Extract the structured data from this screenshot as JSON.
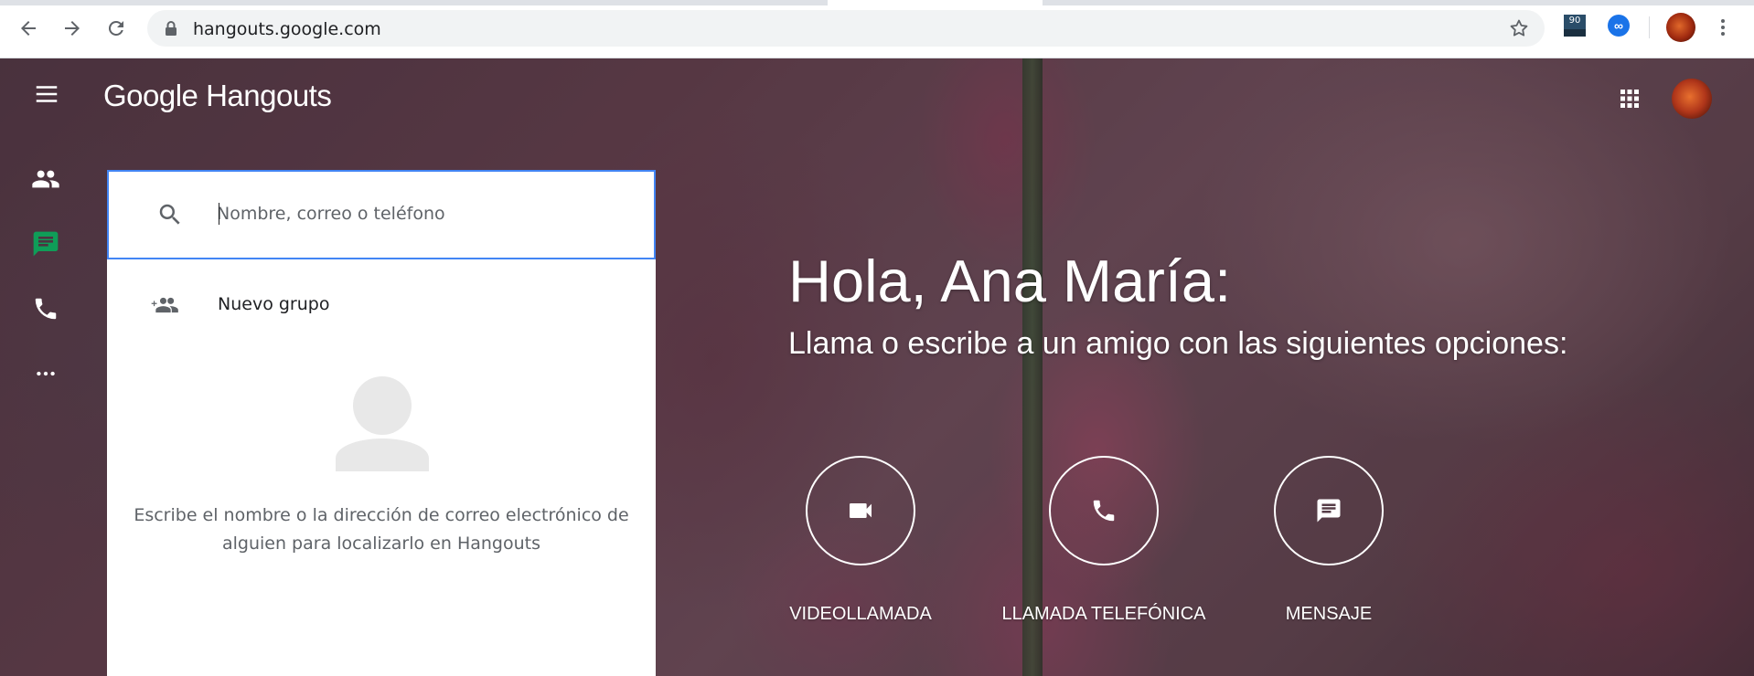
{
  "browser": {
    "url": "hangouts.google.com",
    "extension_badge": "90",
    "extension_infinity": "∞"
  },
  "app": {
    "logo": "Google Hangouts",
    "search": {
      "placeholder": "Nombre, correo o teléfono",
      "value": ""
    },
    "new_group_label": "Nuevo grupo",
    "hint": "Escribe el nombre o la dirección de correo electrónico de alguien para localizarlo en Hangouts",
    "greeting": "Hola, Ana María:",
    "subtitle": "Llama o escribe a un amigo con las siguientes opciones:",
    "actions": [
      {
        "label": "VIDEOLLAMADA",
        "icon": "videocam-icon"
      },
      {
        "label": "LLAMADA TELEFÓNICA",
        "icon": "phone-icon"
      },
      {
        "label": "MENSAJE",
        "icon": "message-icon"
      }
    ],
    "rail": [
      {
        "icon": "contacts-icon",
        "active": false
      },
      {
        "icon": "conversations-icon",
        "active": true
      },
      {
        "icon": "phone-calls-icon",
        "active": false
      },
      {
        "icon": "more-icon",
        "active": false
      }
    ],
    "colors": {
      "accent_green": "#0f9d58",
      "focus_blue": "#4285f4"
    }
  }
}
